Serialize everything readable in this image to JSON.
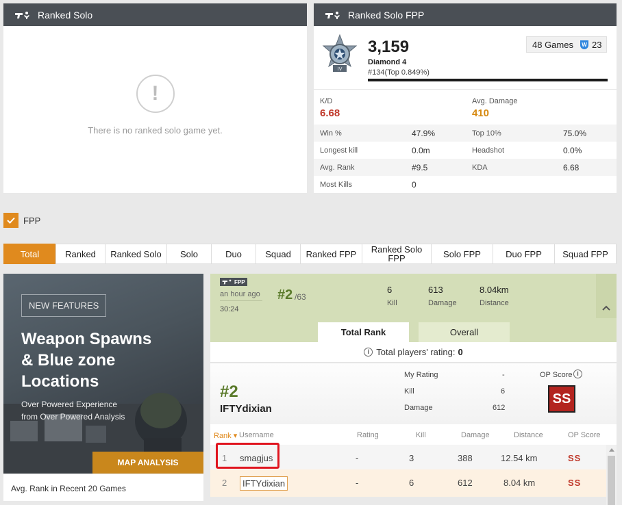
{
  "solo": {
    "title": "Ranked Solo",
    "empty_message": "There is no ranked solo game yet.",
    "empty_icon": "!"
  },
  "solo_fpp": {
    "title": "Ranked Solo FPP",
    "rating": "3,159",
    "tier": "Diamond 4",
    "position": "#134(Top 0.849%)",
    "games": "48 Games",
    "wins_badge": "W",
    "wins": "23",
    "kd_label": "K/D",
    "kd_value": "6.68",
    "avg_damage_label": "Avg. Damage",
    "avg_damage_value": "410",
    "rows": [
      {
        "l1": "Win %",
        "v1": "47.9%",
        "l2": "Top 10%",
        "v2": "75.0%"
      },
      {
        "l1": "Longest kill",
        "v1": "0.0m",
        "l2": "Headshot",
        "v2": "0.0%"
      },
      {
        "l1": "Avg. Rank",
        "v1": "#9.5",
        "l2": "KDA",
        "v2": "6.68"
      },
      {
        "l1": "Most Kills",
        "v1": "0",
        "l2": "",
        "v2": ""
      }
    ],
    "colors": {
      "kd": "#c0392b",
      "damage": "#d68910"
    }
  },
  "fpp_toggle": {
    "label": "FPP",
    "checked": true
  },
  "tabs": [
    "Total",
    "Ranked",
    "Ranked Solo",
    "Solo",
    "Duo",
    "Squad",
    "Ranked FPP",
    "Ranked Solo FPP",
    "Solo FPP",
    "Duo FPP",
    "Squad FPP"
  ],
  "ad": {
    "badge": "NEW FEATURES",
    "headline_1": "Weapon Spawns",
    "headline_2": "& Blue zone",
    "headline_3": "Locations",
    "sub_1": "Over Powered Experience",
    "sub_2": "from Over Powered Analysis",
    "cta": "MAP ANALYSIS"
  },
  "avg_rank_title": "Avg. Rank in Recent 20 Games",
  "match": {
    "mode": "FPP",
    "time_ago": "an hour ago",
    "duration": "30:24",
    "rank": "#2",
    "total": "/63",
    "kill_value": "6",
    "kill_label": "Kill",
    "damage_value": "613",
    "damage_label": "Damage",
    "distance_value": "8.04km",
    "distance_label": "Distance",
    "collapse_icon": "^"
  },
  "rank_tabs": {
    "total": "Total Rank",
    "overall": "Overall"
  },
  "players_rating": {
    "label": "Total players' rating:",
    "value": "0"
  },
  "my_summary": {
    "rank": "#2",
    "name": "IFTYdixian",
    "my_rating_label": "My Rating",
    "my_rating_value": "-",
    "kill_label": "Kill",
    "kill_value": "6",
    "damage_label": "Damage",
    "damage_value": "612",
    "op_label": "OP Score",
    "op_value": "SS"
  },
  "table": {
    "headers": {
      "rank": "Rank ▾",
      "username": "Username",
      "rating": "Rating",
      "kill": "Kill",
      "damage": "Damage",
      "distance": "Distance",
      "op": "OP Score"
    },
    "rows": [
      {
        "rank": "1",
        "username": "smagjus",
        "rating": "-",
        "kill": "3",
        "damage": "388",
        "distance": "12.54 km",
        "op": "SS"
      },
      {
        "rank": "2",
        "username": "IFTYdixian",
        "rating": "-",
        "kill": "6",
        "damage": "612",
        "distance": "8.04 km",
        "op": "SS"
      }
    ]
  }
}
